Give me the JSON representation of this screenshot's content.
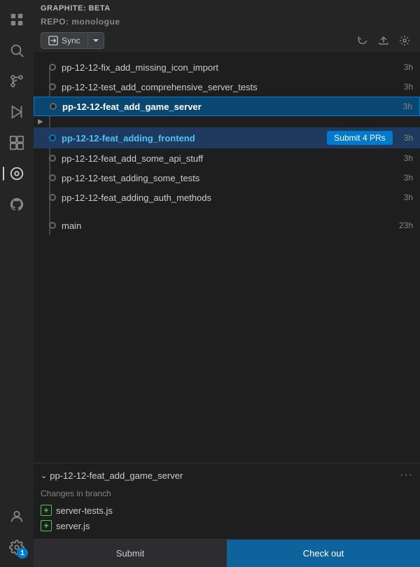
{
  "appTitle": "GRAPHITE: BETA",
  "repo": {
    "label": "REPO: monologue"
  },
  "toolbar": {
    "syncLabel": "Sync",
    "refreshTitle": "Refresh",
    "uploadTitle": "Push",
    "settingsTitle": "Settings"
  },
  "branches": [
    {
      "id": 1,
      "name": "pp-12-12-fix_add_missing_icon_import",
      "time": "3h",
      "selected": false,
      "highlighted": false,
      "dotActive": false
    },
    {
      "id": 2,
      "name": "pp-12-12-test_add_comprehensive_server_tests",
      "time": "3h",
      "selected": false,
      "highlighted": false,
      "dotActive": false
    },
    {
      "id": 3,
      "name": "pp-12-12-feat_add_game_server",
      "time": "3h",
      "selected": true,
      "highlighted": false,
      "dotActive": false
    },
    {
      "id": 4,
      "name": "pp-12-12-feat_adding_frontend",
      "time": "3h",
      "selected": false,
      "highlighted": true,
      "dotActive": true,
      "submitPRs": "Submit 4 PRs"
    },
    {
      "id": 5,
      "name": "pp-12-12-feat_add_some_api_stuff",
      "time": "3h",
      "selected": false,
      "highlighted": false,
      "dotActive": false
    },
    {
      "id": 6,
      "name": "pp-12-12-test_adding_some_tests",
      "time": "3h",
      "selected": false,
      "highlighted": false,
      "dotActive": false
    },
    {
      "id": 7,
      "name": "pp-12-12-feat_adding_auth_methods",
      "time": "3h",
      "selected": false,
      "highlighted": false,
      "dotActive": false
    },
    {
      "id": 8,
      "name": "main",
      "time": "23h",
      "selected": false,
      "highlighted": false,
      "dotActive": false
    }
  ],
  "bottomPanel": {
    "branchName": "pp-12-12-feat_add_game_server",
    "changesLabel": "Changes in branch",
    "files": [
      {
        "name": "server-tests.js"
      },
      {
        "name": "server.js"
      }
    ]
  },
  "footer": {
    "submitLabel": "Submit",
    "checkoutLabel": "Check out"
  },
  "activityIcons": {
    "badge": "1"
  }
}
